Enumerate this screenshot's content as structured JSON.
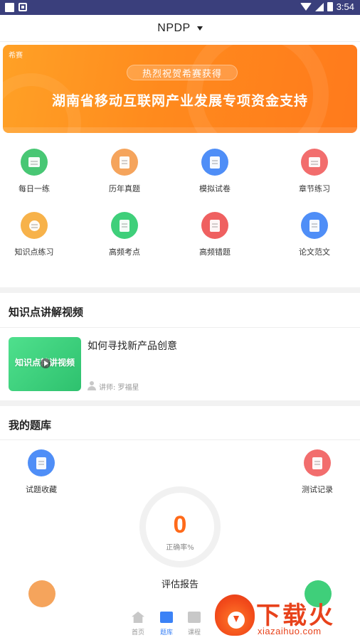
{
  "status_bar": {
    "time": "3:54"
  },
  "header": {
    "title": "NPDP"
  },
  "banner": {
    "logo": "希赛",
    "pill": "热烈祝贺希赛获得",
    "headline": "湖南省移动互联网产业发展专项资金支持"
  },
  "grid": [
    {
      "label": "每日一练",
      "color": "#48c774",
      "icon": "calendar-icon"
    },
    {
      "label": "历年真题",
      "color": "#f5a45c",
      "icon": "bookmark-book-icon"
    },
    {
      "label": "模拟试卷",
      "color": "#4f8ef7",
      "icon": "scroll-icon"
    },
    {
      "label": "章节练习",
      "color": "#f26d6d",
      "icon": "layers-icon"
    },
    {
      "label": "知识点练习",
      "color": "#f7b24a",
      "icon": "lightbulb-icon"
    },
    {
      "label": "高频考点",
      "color": "#3fcf7a",
      "icon": "crown-book-icon"
    },
    {
      "label": "高频错题",
      "color": "#ef6060",
      "icon": "pen-book-icon"
    },
    {
      "label": "论文范文",
      "color": "#4f8ef7",
      "icon": "document-icon"
    }
  ],
  "video_section": {
    "title": "知识点讲解视频",
    "item": {
      "thumb_text": "知识点精讲视频",
      "title": "如何寻找新产品创意",
      "lecturer": "讲师: 罗福星"
    }
  },
  "bank_section": {
    "title": "我的题库",
    "favorites_label": "试题收藏",
    "records_label": "测试记录",
    "accuracy_value": "0",
    "accuracy_label": "正确率%",
    "report_label": "评估报告"
  },
  "tabs": [
    {
      "label": "首页",
      "active": false
    },
    {
      "label": "题库",
      "active": true
    },
    {
      "label": "课程",
      "active": false
    }
  ],
  "watermark": {
    "brand": "下载火",
    "url": "xiazaihuo.com"
  }
}
